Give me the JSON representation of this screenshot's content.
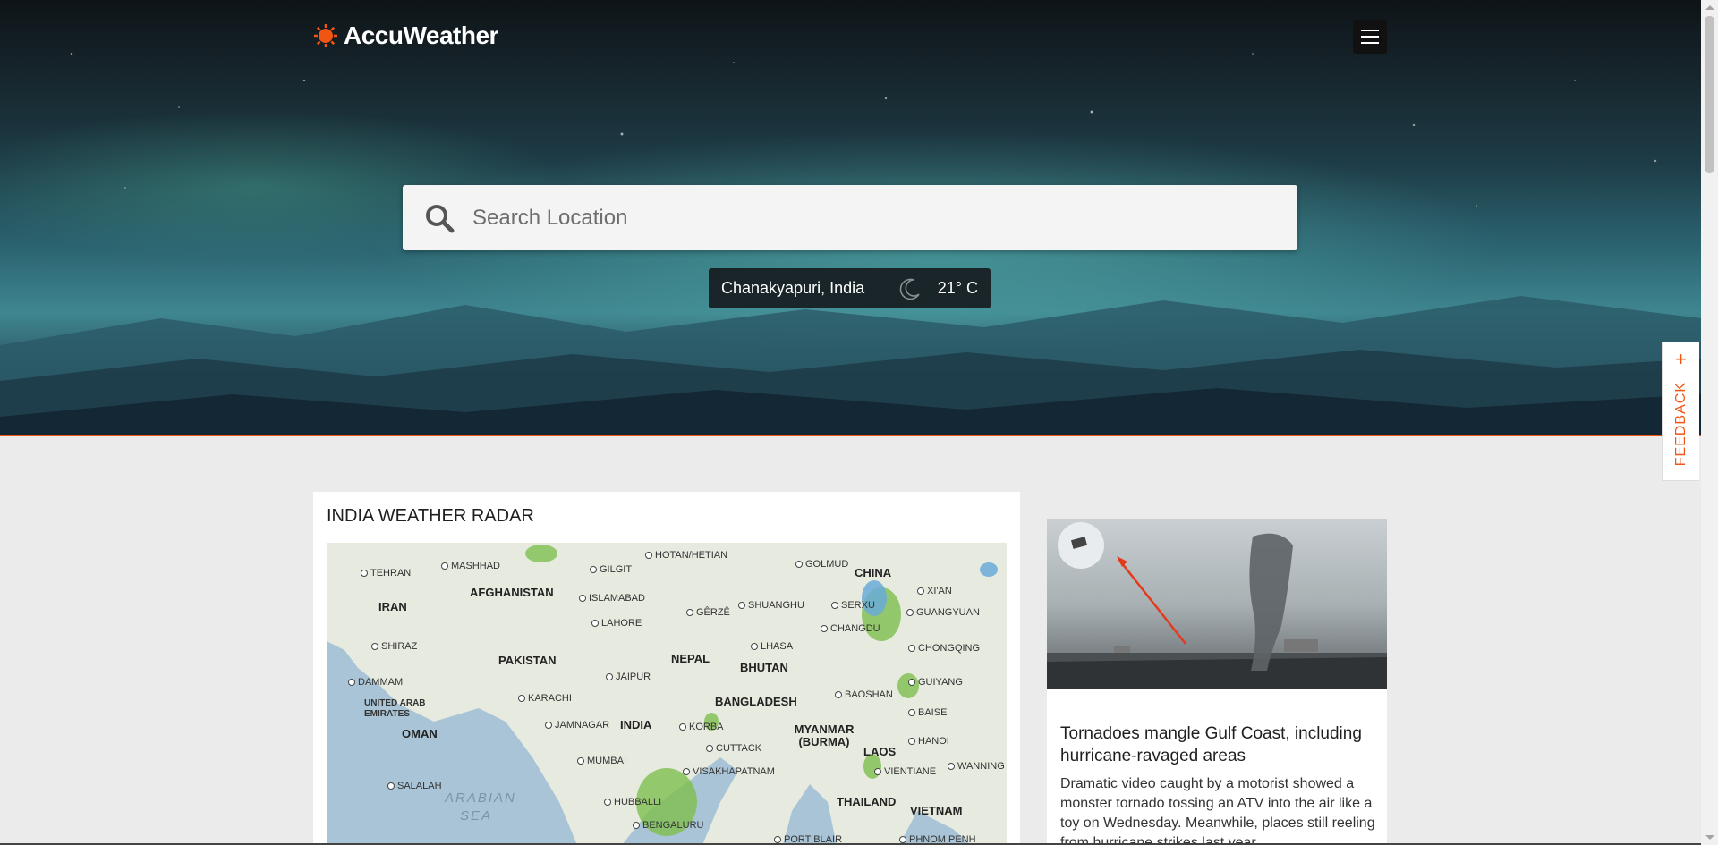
{
  "header": {
    "brand": "AccuWeather",
    "menu_icon": "hamburger-menu-icon",
    "accent_color": "#f05514"
  },
  "search": {
    "placeholder": "Search Location",
    "icon": "search-icon"
  },
  "recent_location": {
    "name": "Chanakyapuri, India",
    "condition_icon": "moon-icon",
    "temperature": "21° C"
  },
  "feedback": {
    "label": "FEEDBACK",
    "icon": "plus-icon"
  },
  "radar": {
    "title": "INDIA WEATHER RADAR",
    "labels": {
      "countries": [
        "IRAN",
        "AFGHANISTAN",
        "PAKISTAN",
        "NEPAL",
        "BHUTAN",
        "CHINA",
        "BANGLADESH",
        "INDIA",
        "OMAN",
        "MYANMAR (BURMA)",
        "LAOS",
        "THAILAND",
        "VIETNAM",
        "UNITED ARAB EMIRATES"
      ],
      "cities": [
        "TEHRAN",
        "MASHHAD",
        "SHIRAZ",
        "DAMMAM",
        "KARACHI",
        "LAHORE",
        "ISLAMABAD",
        "GILGIT",
        "HOTAN/HETIAN",
        "GOLMUD",
        "XI'AN",
        "GUANGYUAN",
        "CHONGQING",
        "GUIYANG",
        "BAISE",
        "HANOI",
        "VIENTIANE",
        "WANNING",
        "SHUANGHU",
        "SERXU",
        "CHANGDU",
        "GÊRZÊ",
        "LHASA",
        "JAIPUR",
        "BAOSHAN",
        "KORBA",
        "JAMNAGAR",
        "MUMBAI",
        "CUTTACK",
        "VISAKHAPATNAM",
        "HUBBALLI",
        "BENGALURU",
        "SALALAH",
        "PORT BLAIR",
        "PHNOM PENH"
      ],
      "seas": [
        "ARABIAN SEA"
      ]
    }
  },
  "news": {
    "title": "Tornadoes mangle Gulf Coast, including hurricane-ravaged areas",
    "description": "Dramatic video caught by a motorist showed a monster tornado tossing an ATV into the air like a toy on Wednesday. Meanwhile, places still reeling from hurricane strikes last year"
  }
}
